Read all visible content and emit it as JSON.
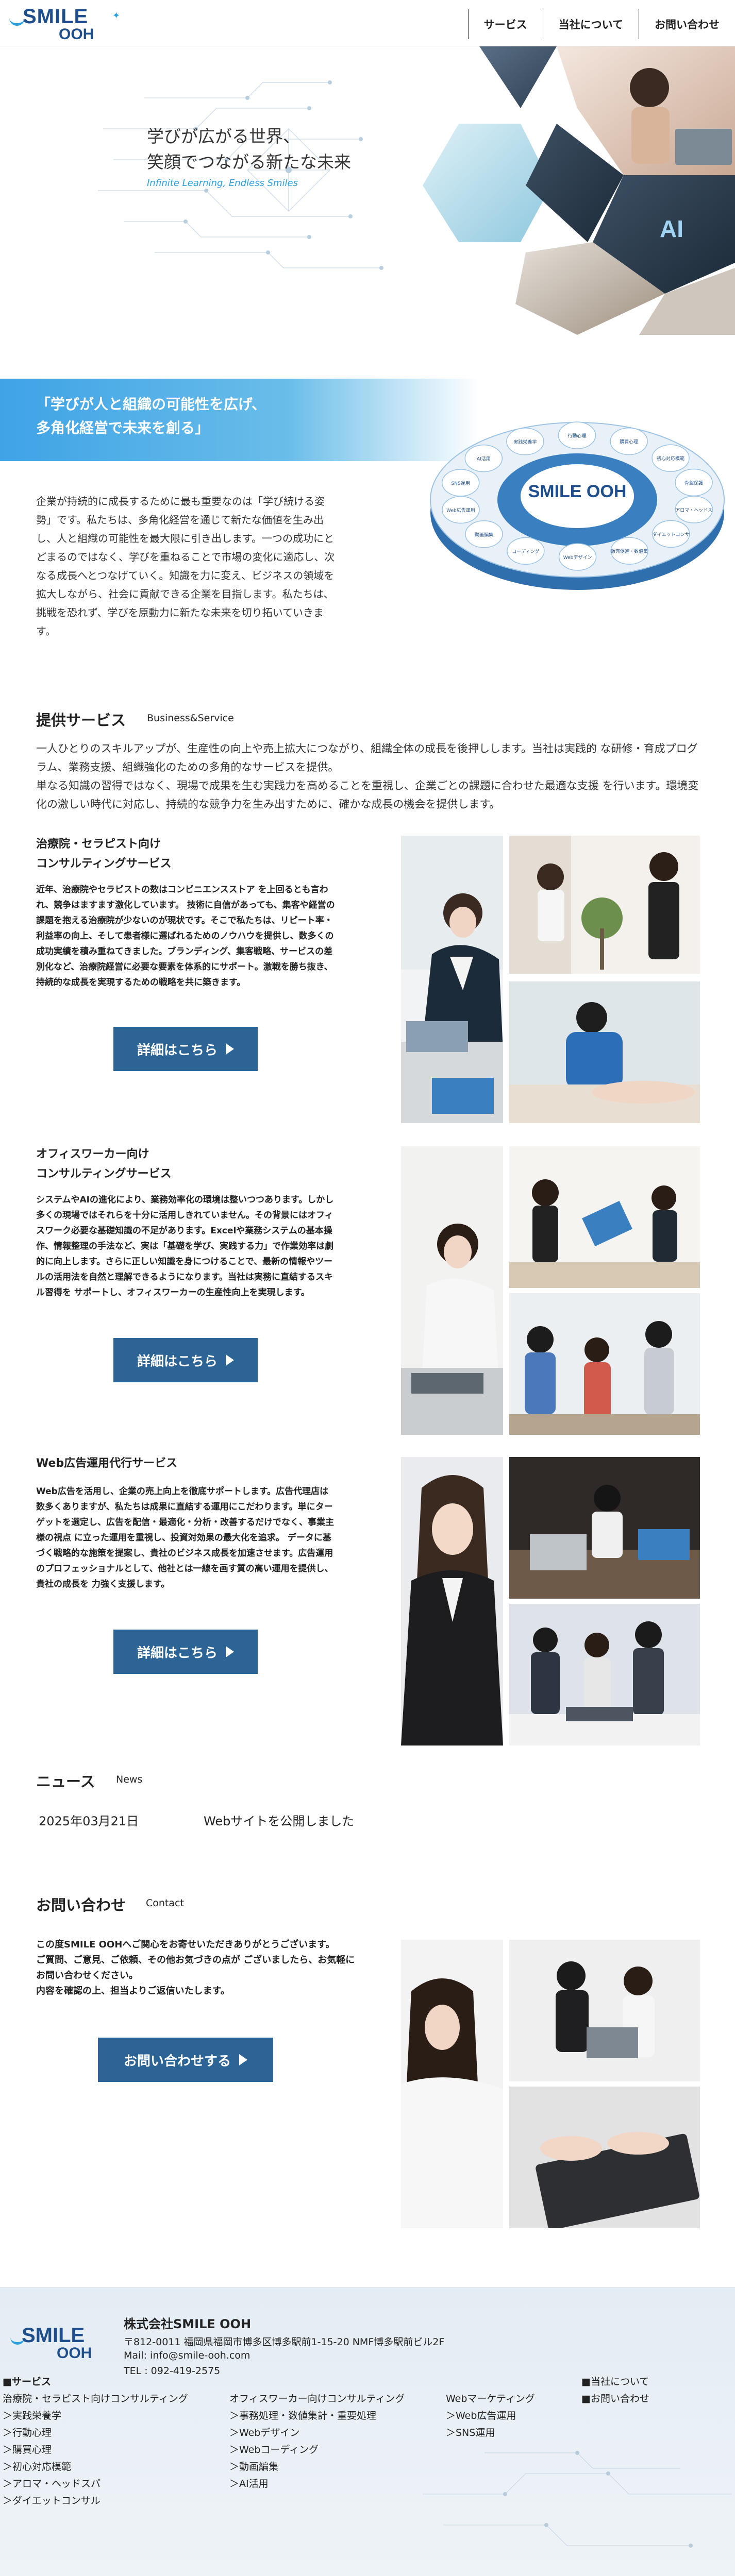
{
  "header": {
    "logo_text": "SMILE OOH",
    "nav": [
      "サービス",
      "当社について",
      "お問い合わせ"
    ]
  },
  "hero": {
    "title_line1": "学びが広がる世界、",
    "title_line2": "笑顔でつながる新たな未来",
    "tagline": "Infinite Learning, Endless Smiles"
  },
  "mission": {
    "heading_line1": "「学びが人と組織の可能性を広げ、",
    "heading_line2": "多角化経営で未来を創る」",
    "body": "企業が持続的に成長するために最も重要なのは「学び続ける姿勢」です。私たちは、多角化経営を通じて新たな価値を生み出し、人と組織の可能性を最大限に引き出します。一つの成功にとどまるのではなく、学びを重ねることで市場の変化に適応し、次なる成長へとつなげていく。知識を力に変え、ビジネスの領域を拡大しながら、社会に貢献できる企業を目指します。私たちは、挑戦を恐れず、学びを原動力に新たな未来を切り拓いていきます。",
    "diagram_center": "SMILE OOH",
    "diagram_items": [
      "AI活用",
      "実践栄養学",
      "行動心理",
      "購買心理",
      "初心対応模範",
      "骨盤保護",
      "アロマ・ヘッドスパ",
      "ダイエットコンサル",
      "販売促進・数値集計・重要機能",
      "Webデザイン",
      "コーディング",
      "動画編集",
      "Web広告運用",
      "SNS運用"
    ]
  },
  "services": {
    "title": "提供サービス",
    "subtitle": "Business&Service",
    "intro": "一人ひとりのスキルアップが、生産性の向上や売上拡大につながり、組織全体の成長を後押しします。当社は実践的 な研修・育成プログラム、業務支援、組織強化のための多角的なサービスを提供。\n単なる知識の習得ではなく、現場で成果を生む実践力を高めることを重視し、企業ごとの課題に合わせた最適な支援 を行います。環境変化の激しい時代に対応し、持続的な競争力を生み出すために、確かな成長の機会を提供します。",
    "items": [
      {
        "title_line1": "治療院・セラピスト向け",
        "title_line2": "コンサルティングサービス",
        "body": "近年、治療院やセラピストの数はコンビニエンスストア を上回るとも言われ、競争はますます激化しています。 技術に自信があっても、集客や経営の課題を抱える治療院が少ないのが現状です。そこで私たちは、リピート率・利益率の向上、そして患者様に選ばれるためのノウハウを提供し、数多くの成功実績を積み重ねてきました。ブランディング、集客戦略、サービスの差別化など、治療院経営に必要な要素を体系的にサポート。激戦を勝ち抜き、持続的な成長を実現するための戦略を共に築きます。",
        "button": "詳細はこちら"
      },
      {
        "title_line1": "オフィスワーカー向け",
        "title_line2": "コンサルティングサービス",
        "body": "システムやAIの進化により、業務効率化の環境は整いつつあります。しかし多くの現場ではそれらを十分に活用しきれていません。その背景にはオフィスワーク必要な基礎知識の不足があります。Excelや業務システムの基本操作、情報整理の手法など、実は「基礎を学び、実践する力」で作業効率は劇的に向上します。さらに正しい知識を身につけることで、最新の情報やツールの活用法を自然と理解できるようになります。当社は実務に直結するスキル習得を サポートし、オフィスワーカーの生産性向上を実現します。",
        "button": "詳細はこちら"
      },
      {
        "title_line1": "Web広告運用代行サービス",
        "title_line2": "",
        "body": "Web広告を活用し、企業の売上向上を徹底サポートします。広告代理店は数多くありますが、私たちは成果に直結する運用にこだわります。単にターゲットを選定し、広告を配信・最適化・分析・改善するだけでなく、事業主様の視点 に立った運用を重視し、投資対効果の最大化を追求。\nデータに基づく戦略的な施策を提案し、貴社のビジネス成長を加速させます。広告運用のプロフェッショナルとして、他社とは一線を画す質の高い運用を提供し、貴社の成長を 力強く支援します。",
        "button": "詳細はこちら"
      }
    ]
  },
  "news": {
    "title": "ニュース",
    "subtitle": "News",
    "items": [
      {
        "date": "2025年03月21日",
        "text": "Webサイトを公開しました"
      }
    ]
  },
  "contact": {
    "title": "お問い合わせ",
    "subtitle": "Contact",
    "body": "この度SMILE OOHへご関心をお寄せいただきありがとうございます。\nご質問、ご意見、ご依頼、その他お気づきの点が ございましたら、お気軽にお問い合わせください。\n内容を確認の上、担当よりご返信いたします。",
    "button": "お問い合わせする"
  },
  "footer": {
    "company": "株式会社SMILE OOH",
    "address": "〒812-0011 福岡県福岡市博多区博多駅前1-15-20 NMF博多駅前ビル2F",
    "mail": "Mail: info@smile-ooh.com",
    "tel": "TEL : 092-419-2575",
    "col1_head": "■サービス",
    "col1": [
      "治療院・セラピスト向けコンサルティング",
      "＞実践栄養学",
      "＞行動心理",
      "＞購買心理",
      "＞初心対応模範",
      "＞アロマ・ヘッドスパ",
      "＞ダイエットコンサル"
    ],
    "col2": [
      "オフィスワーカー向けコンサルティング",
      "＞事務処理・数値集計・重要処理",
      "＞Webデザイン",
      "＞Webコーディング",
      "＞動画編集",
      "＞AI活用"
    ],
    "col3": [
      "Webマーケティング",
      "＞Web広告運用",
      "＞SNS運用"
    ],
    "col4": [
      "■当社について",
      "■お問い合わせ"
    ]
  },
  "colors": {
    "brand": "#1f4e8c",
    "accent": "#2aa0e0",
    "button": "#2c6496"
  }
}
